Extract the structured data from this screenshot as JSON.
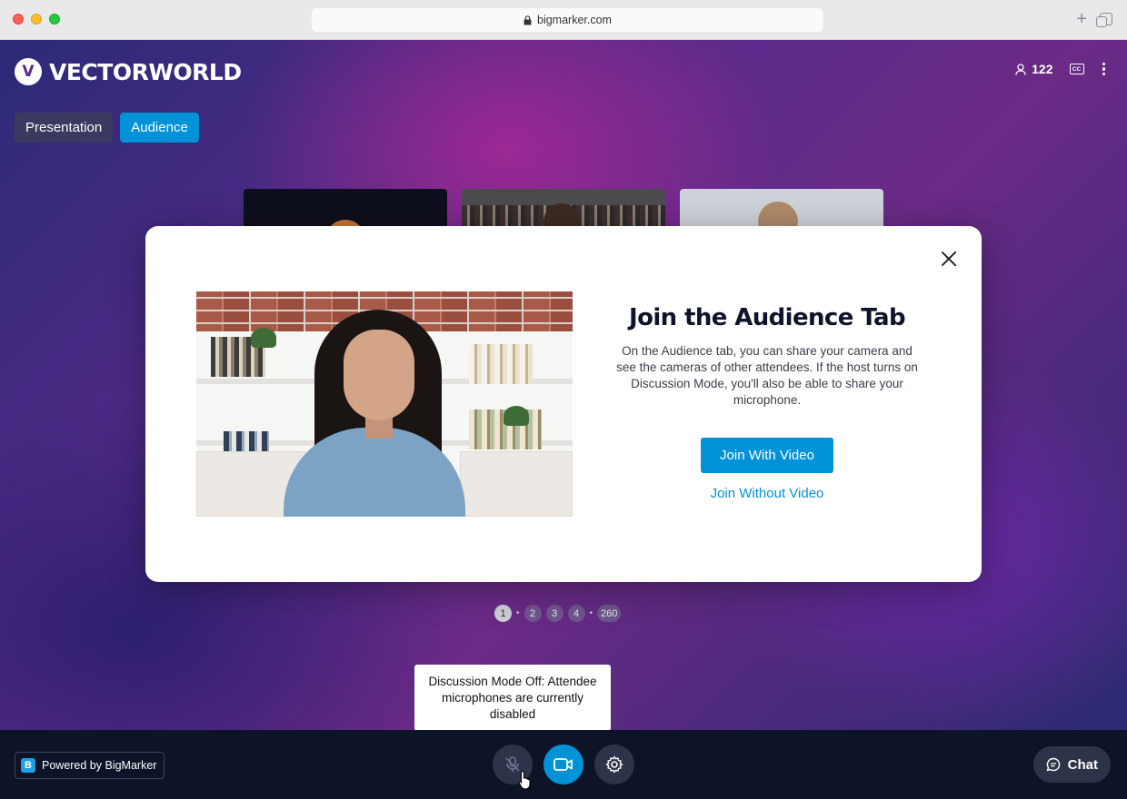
{
  "browser": {
    "url": "bigmarker.com"
  },
  "header": {
    "brand": "VECTORWORLD",
    "attendee_count": "122"
  },
  "tabs": [
    {
      "label": "Presentation",
      "active": false
    },
    {
      "label": "Audience",
      "active": true
    }
  ],
  "pagination": {
    "current": "1",
    "pages": [
      "2",
      "3",
      "4"
    ],
    "last": "260"
  },
  "modal": {
    "title": "Join the Audience Tab",
    "body": "On the Audience tab, you can share your camera and see the cameras of other attendees. If the host turns on Discussion Mode, you'll also be able to share your microphone.",
    "primary_button": "Join With Video",
    "secondary_link": "Join Without Video"
  },
  "tooltip": {
    "text": "Discussion Mode Off: Attendee microphones are currently disabled"
  },
  "footer": {
    "powered_by": "Powered by BigMarker",
    "chat_label": "Chat"
  },
  "colors": {
    "accent": "#0092d6",
    "footer_bg": "#0d1428",
    "control_bg": "#2d3348"
  },
  "icons": [
    "lock-icon",
    "new-tab-icon",
    "tabs-overview-icon",
    "person-icon",
    "closed-captions-icon",
    "more-options-icon",
    "close-icon",
    "microphone-off-icon",
    "camera-icon",
    "settings-icon",
    "chat-icon",
    "bigmarker-logo-icon"
  ]
}
